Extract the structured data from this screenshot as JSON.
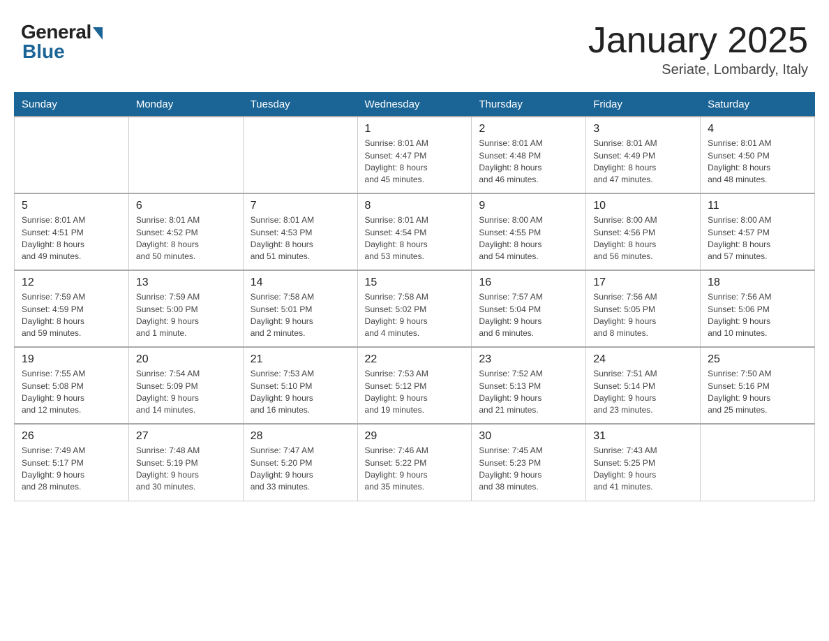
{
  "header": {
    "logo_general": "General",
    "logo_blue": "Blue",
    "title": "January 2025",
    "location": "Seriate, Lombardy, Italy"
  },
  "days_of_week": [
    "Sunday",
    "Monday",
    "Tuesday",
    "Wednesday",
    "Thursday",
    "Friday",
    "Saturday"
  ],
  "weeks": [
    [
      {
        "day": "",
        "info": ""
      },
      {
        "day": "",
        "info": ""
      },
      {
        "day": "",
        "info": ""
      },
      {
        "day": "1",
        "info": "Sunrise: 8:01 AM\nSunset: 4:47 PM\nDaylight: 8 hours\nand 45 minutes."
      },
      {
        "day": "2",
        "info": "Sunrise: 8:01 AM\nSunset: 4:48 PM\nDaylight: 8 hours\nand 46 minutes."
      },
      {
        "day": "3",
        "info": "Sunrise: 8:01 AM\nSunset: 4:49 PM\nDaylight: 8 hours\nand 47 minutes."
      },
      {
        "day": "4",
        "info": "Sunrise: 8:01 AM\nSunset: 4:50 PM\nDaylight: 8 hours\nand 48 minutes."
      }
    ],
    [
      {
        "day": "5",
        "info": "Sunrise: 8:01 AM\nSunset: 4:51 PM\nDaylight: 8 hours\nand 49 minutes."
      },
      {
        "day": "6",
        "info": "Sunrise: 8:01 AM\nSunset: 4:52 PM\nDaylight: 8 hours\nand 50 minutes."
      },
      {
        "day": "7",
        "info": "Sunrise: 8:01 AM\nSunset: 4:53 PM\nDaylight: 8 hours\nand 51 minutes."
      },
      {
        "day": "8",
        "info": "Sunrise: 8:01 AM\nSunset: 4:54 PM\nDaylight: 8 hours\nand 53 minutes."
      },
      {
        "day": "9",
        "info": "Sunrise: 8:00 AM\nSunset: 4:55 PM\nDaylight: 8 hours\nand 54 minutes."
      },
      {
        "day": "10",
        "info": "Sunrise: 8:00 AM\nSunset: 4:56 PM\nDaylight: 8 hours\nand 56 minutes."
      },
      {
        "day": "11",
        "info": "Sunrise: 8:00 AM\nSunset: 4:57 PM\nDaylight: 8 hours\nand 57 minutes."
      }
    ],
    [
      {
        "day": "12",
        "info": "Sunrise: 7:59 AM\nSunset: 4:59 PM\nDaylight: 8 hours\nand 59 minutes."
      },
      {
        "day": "13",
        "info": "Sunrise: 7:59 AM\nSunset: 5:00 PM\nDaylight: 9 hours\nand 1 minute."
      },
      {
        "day": "14",
        "info": "Sunrise: 7:58 AM\nSunset: 5:01 PM\nDaylight: 9 hours\nand 2 minutes."
      },
      {
        "day": "15",
        "info": "Sunrise: 7:58 AM\nSunset: 5:02 PM\nDaylight: 9 hours\nand 4 minutes."
      },
      {
        "day": "16",
        "info": "Sunrise: 7:57 AM\nSunset: 5:04 PM\nDaylight: 9 hours\nand 6 minutes."
      },
      {
        "day": "17",
        "info": "Sunrise: 7:56 AM\nSunset: 5:05 PM\nDaylight: 9 hours\nand 8 minutes."
      },
      {
        "day": "18",
        "info": "Sunrise: 7:56 AM\nSunset: 5:06 PM\nDaylight: 9 hours\nand 10 minutes."
      }
    ],
    [
      {
        "day": "19",
        "info": "Sunrise: 7:55 AM\nSunset: 5:08 PM\nDaylight: 9 hours\nand 12 minutes."
      },
      {
        "day": "20",
        "info": "Sunrise: 7:54 AM\nSunset: 5:09 PM\nDaylight: 9 hours\nand 14 minutes."
      },
      {
        "day": "21",
        "info": "Sunrise: 7:53 AM\nSunset: 5:10 PM\nDaylight: 9 hours\nand 16 minutes."
      },
      {
        "day": "22",
        "info": "Sunrise: 7:53 AM\nSunset: 5:12 PM\nDaylight: 9 hours\nand 19 minutes."
      },
      {
        "day": "23",
        "info": "Sunrise: 7:52 AM\nSunset: 5:13 PM\nDaylight: 9 hours\nand 21 minutes."
      },
      {
        "day": "24",
        "info": "Sunrise: 7:51 AM\nSunset: 5:14 PM\nDaylight: 9 hours\nand 23 minutes."
      },
      {
        "day": "25",
        "info": "Sunrise: 7:50 AM\nSunset: 5:16 PM\nDaylight: 9 hours\nand 25 minutes."
      }
    ],
    [
      {
        "day": "26",
        "info": "Sunrise: 7:49 AM\nSunset: 5:17 PM\nDaylight: 9 hours\nand 28 minutes."
      },
      {
        "day": "27",
        "info": "Sunrise: 7:48 AM\nSunset: 5:19 PM\nDaylight: 9 hours\nand 30 minutes."
      },
      {
        "day": "28",
        "info": "Sunrise: 7:47 AM\nSunset: 5:20 PM\nDaylight: 9 hours\nand 33 minutes."
      },
      {
        "day": "29",
        "info": "Sunrise: 7:46 AM\nSunset: 5:22 PM\nDaylight: 9 hours\nand 35 minutes."
      },
      {
        "day": "30",
        "info": "Sunrise: 7:45 AM\nSunset: 5:23 PM\nDaylight: 9 hours\nand 38 minutes."
      },
      {
        "day": "31",
        "info": "Sunrise: 7:43 AM\nSunset: 5:25 PM\nDaylight: 9 hours\nand 41 minutes."
      },
      {
        "day": "",
        "info": ""
      }
    ]
  ]
}
